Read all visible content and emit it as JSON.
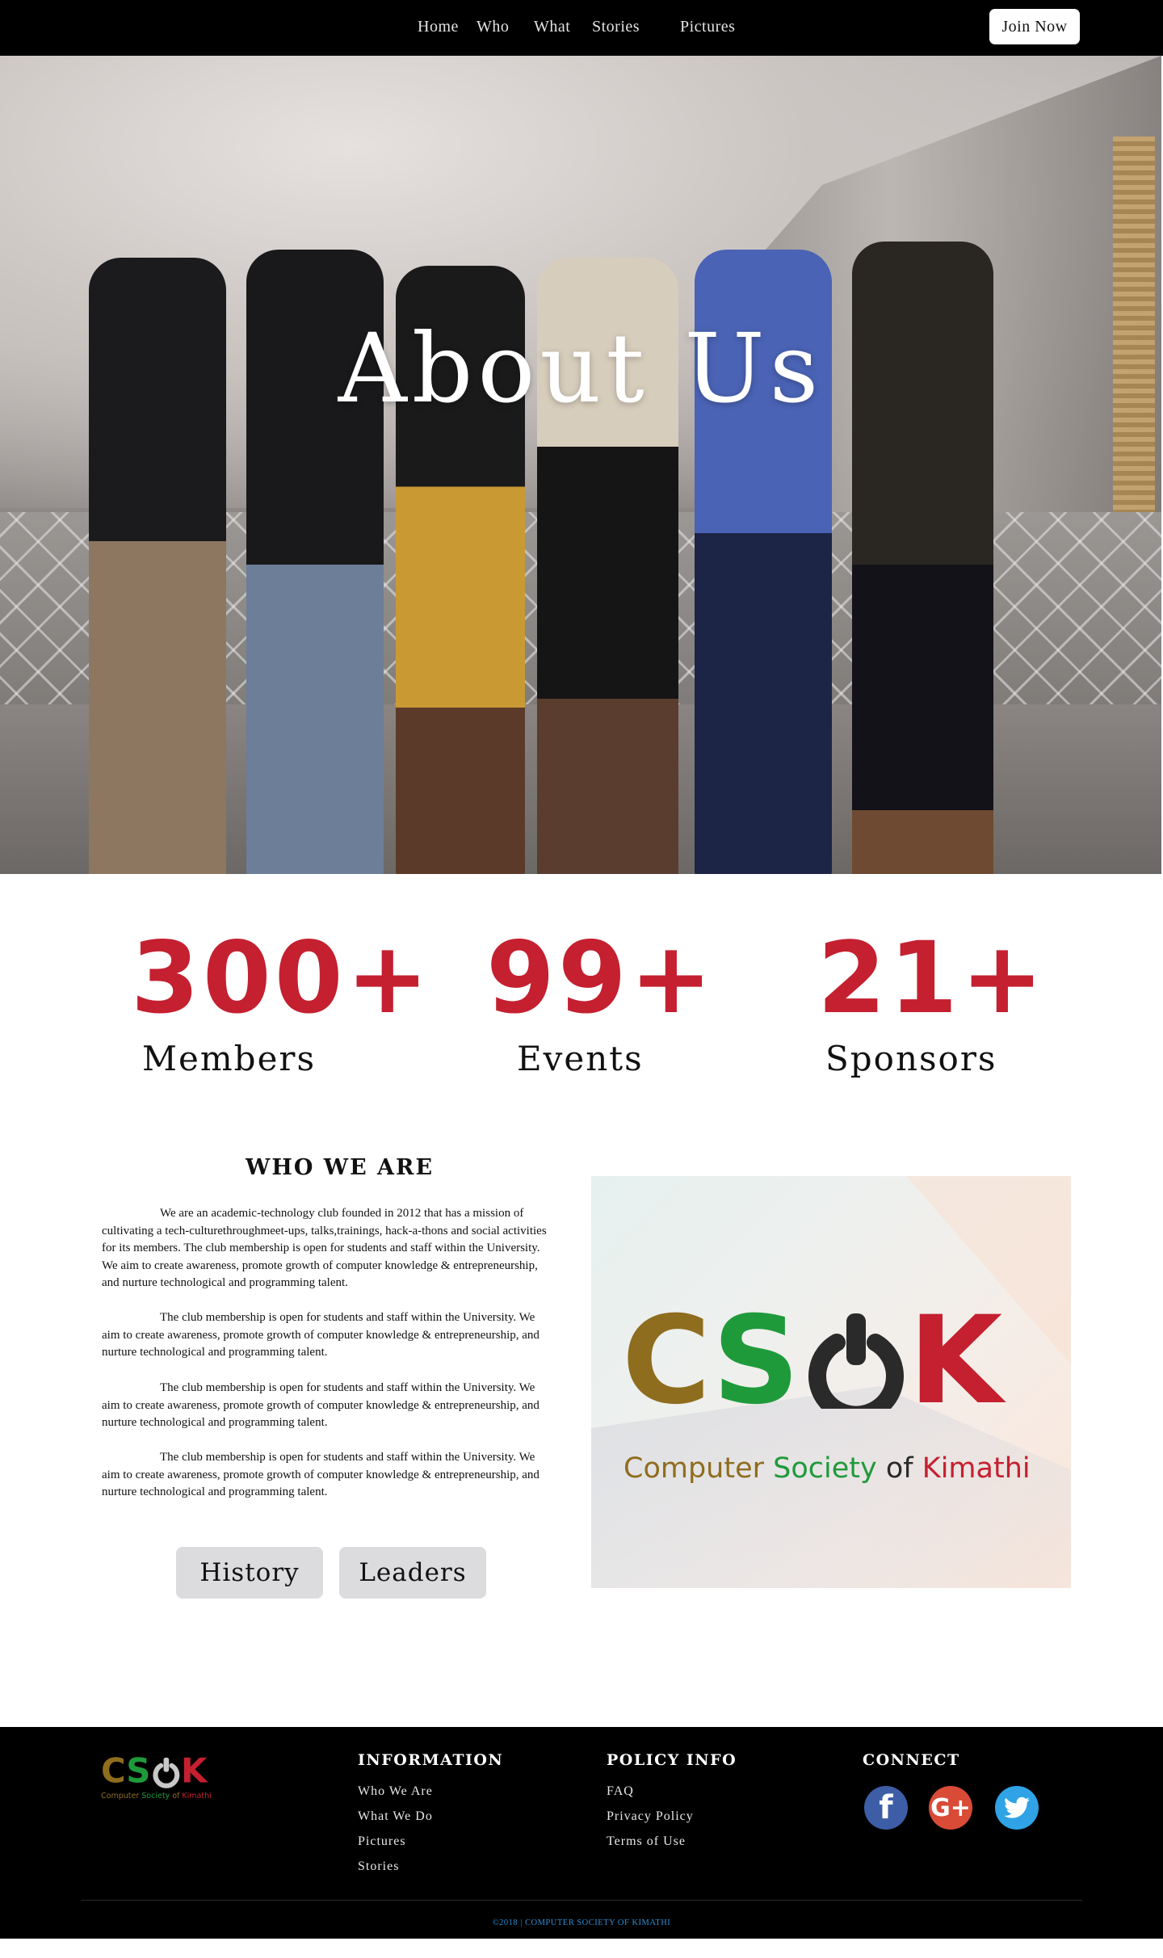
{
  "nav": {
    "items": [
      {
        "label": "Home"
      },
      {
        "label": "Who"
      },
      {
        "label": "What"
      },
      {
        "label": "Stories"
      },
      {
        "label": "Pictures"
      }
    ],
    "join_label": "Join Now"
  },
  "hero": {
    "title": "About Us"
  },
  "stats": [
    {
      "value": "300+",
      "label": "Members"
    },
    {
      "value": "99+",
      "label": "Events"
    },
    {
      "value": "21+",
      "label": "Sponsors"
    }
  ],
  "who": {
    "title": "WHO WE ARE",
    "paragraphs": [
      "We are an academic-technology club founded in 2012 that has a mission of cultivating a tech-culturethroughmeet-ups, talks,trainings, hack-a-thons and social activities for its members.  The club membership is open for students and staff within the University. We aim to create awareness, promote growth of computer knowledge & entrepreneurship, and nurture technological and programming talent.",
      "The club membership is open for students and staff within the University. We aim to create awareness, promote growth of computer knowledge & entrepreneurship, and nurture technological and programming talent.",
      "The club membership is open for students and staff within the University. We aim to create awareness, promote growth of computer knowledge & entrepreneurship, and nurture technological and programming talent.",
      "The club membership is open for students and staff within the University. We aim to create awareness, promote growth of computer knowledge & entrepreneurship, and nurture technological and programming talent."
    ],
    "history_label": "History",
    "leaders_label": "Leaders"
  },
  "logo": {
    "letters": [
      "C",
      "S",
      "K"
    ],
    "subtitle_parts": [
      "Computer",
      "Society",
      "of",
      "Kimathi"
    ],
    "colors": {
      "gold": "#8f6d1e",
      "green": "#1f9a3b",
      "dark": "#2a2a2a",
      "red": "#c42030"
    }
  },
  "footer": {
    "information": {
      "heading": "INFORMATION",
      "links": [
        "Who We Are",
        "What We Do",
        "Pictures",
        "Stories"
      ]
    },
    "policy": {
      "heading": "POLICY INFO",
      "links": [
        "FAQ",
        "Privacy Policy",
        "Terms of Use"
      ]
    },
    "connect": {
      "heading": "CONNECT",
      "icons": [
        "facebook-icon",
        "google-plus-icon",
        "twitter-icon"
      ]
    },
    "copyright": "©2018 | COMPUTER SOCIETY OF KIMATHI"
  },
  "colors": {
    "accent_red": "#c42030",
    "nav_bg": "#000000",
    "pill_bg": "#dcdcdf",
    "copyright_blue": "#2f8ed6"
  }
}
